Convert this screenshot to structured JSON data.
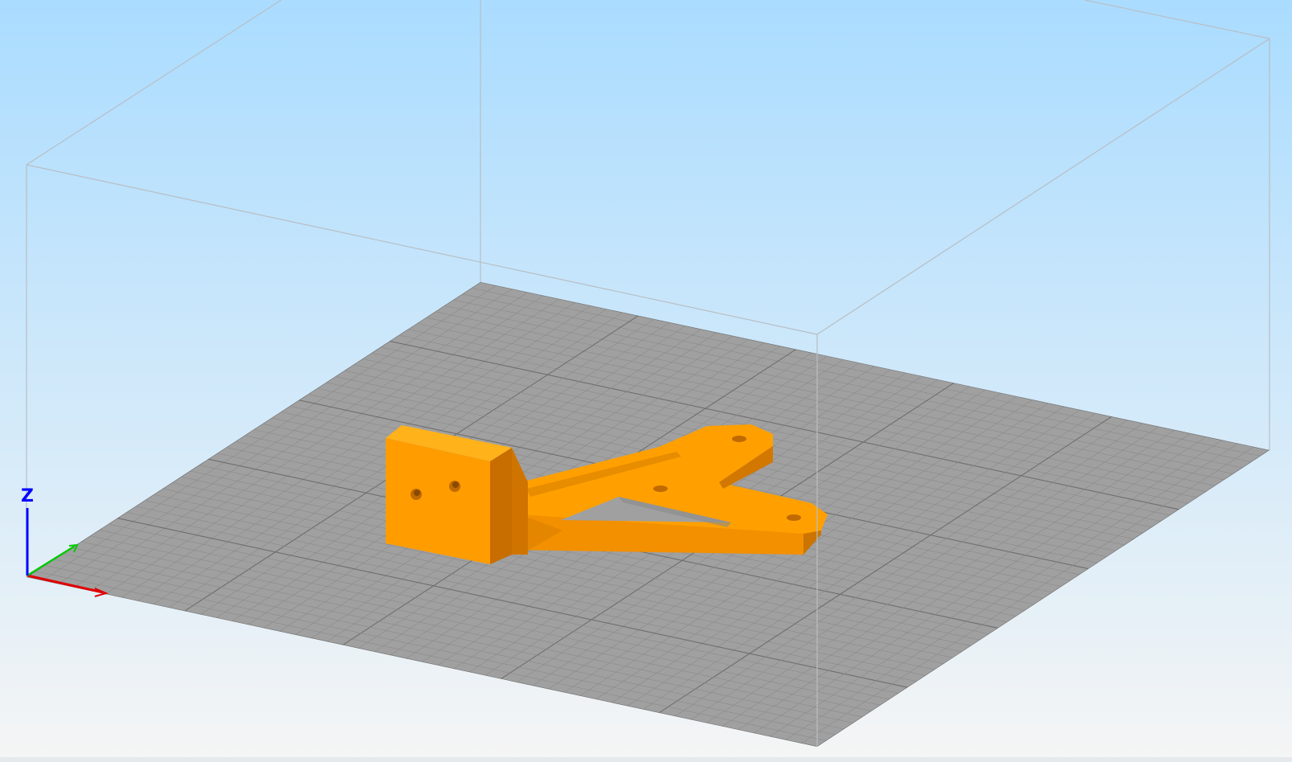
{
  "window": {
    "background_top": "#aadcff",
    "background_bottom": "#f5f5f5"
  },
  "build_plate": {
    "color": "#a0a0a0",
    "grid_minor_color": "#8a8a8a",
    "grid_major_color": "#6e6e6e",
    "grid": true
  },
  "build_volume": {
    "edge_color": "#b8bec4"
  },
  "model": {
    "color": "#ffa000",
    "shade_dark": "#c86e00",
    "shade_mid": "#e88c00",
    "hole_color": "#b06000"
  },
  "axes": {
    "z_label": "Z",
    "x_color": "#e00000",
    "y_color": "#00c800",
    "z_color": "#0000ff"
  }
}
